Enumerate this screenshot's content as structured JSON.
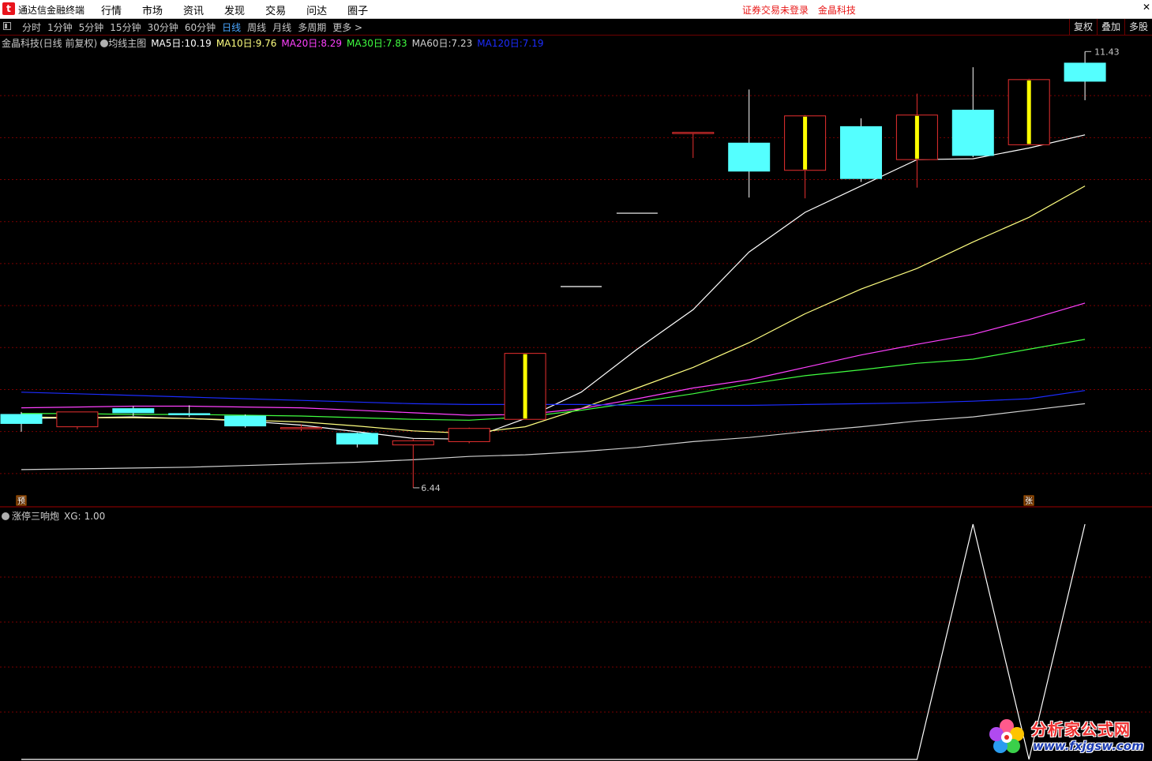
{
  "app": {
    "name": "通达信金融终端",
    "menu": [
      "行情",
      "市场",
      "资讯",
      "发现",
      "交易",
      "问达",
      "圈子"
    ],
    "status_login": "证券交易未登录",
    "status_stock": "金晶科技",
    "close_glyph": "✕"
  },
  "toolbar": {
    "tabs": [
      "分时",
      "1分钟",
      "5分钟",
      "15分钟",
      "30分钟",
      "60分钟",
      "日线",
      "周线",
      "月线",
      "多周期",
      "更多 >"
    ],
    "active_tab": "日线",
    "right_buttons": [
      "复权",
      "叠加",
      "多股"
    ]
  },
  "main_legend": {
    "stock": "金晶科技(日线 前复权)",
    "indicator": "均线主图",
    "ma": [
      {
        "label": "MA5日:",
        "value": "10.19",
        "color": "#ffffff"
      },
      {
        "label": "MA10日:",
        "value": "9.76",
        "color": "#ffff80"
      },
      {
        "label": "MA20日:",
        "value": "8.29",
        "color": "#ff40ff"
      },
      {
        "label": "MA30日:",
        "value": "7.83",
        "color": "#40ff40"
      },
      {
        "label": "MA60日:",
        "value": "7.23",
        "color": "#d0d0d0"
      },
      {
        "label": "MA120日:",
        "value": "7.19",
        "color": "#1c2cff"
      }
    ]
  },
  "sub_legend": {
    "name": "涨停三响炮",
    "label": "XG:",
    "value": "1.00"
  },
  "markers": {
    "low_price_label": "6.44",
    "high_price_label": "11.43",
    "start_tag": "预",
    "limit_tag": "张"
  },
  "watermark": {
    "line1": "分析家公式网",
    "line2": "www.fxjgsw.com"
  },
  "colors": {
    "up": "#e83030",
    "down": "#54ffff",
    "limit_body": "#ffff00",
    "grid": "#7a0000",
    "frame": "#a00000"
  },
  "chart_data": {
    "type": "candlestick",
    "price_range": [
      6.2,
      11.8
    ],
    "candles": [
      {
        "open": 7.33,
        "close": 7.22,
        "high": 7.36,
        "low": 7.12
      },
      {
        "open": 7.18,
        "close": 7.36,
        "high": 7.36,
        "low": 7.15
      },
      {
        "open": 7.4,
        "close": 7.35,
        "high": 7.43,
        "low": 7.31
      },
      {
        "open": 7.34,
        "close": 7.33,
        "high": 7.44,
        "low": 7.3
      },
      {
        "open": 7.31,
        "close": 7.19,
        "high": 7.33,
        "low": 7.17
      },
      {
        "open": 7.17,
        "close": 7.17,
        "high": 7.21,
        "low": 7.13
      },
      {
        "open": 7.1,
        "close": 6.97,
        "high": 7.11,
        "low": 6.93
      },
      {
        "open": 6.96,
        "close": 7.01,
        "high": 7.03,
        "low": 6.44
      },
      {
        "open": 7.0,
        "close": 7.16,
        "high": 7.17,
        "low": 6.98
      },
      {
        "open": 7.27,
        "close": 8.07,
        "high": 8.07,
        "low": 7.27,
        "limit_up": true
      },
      {
        "open": 8.88,
        "close": 8.88,
        "high": 8.88,
        "low": 8.88,
        "one_price": true
      },
      {
        "open": 9.77,
        "close": 9.77,
        "high": 9.77,
        "low": 9.77,
        "one_price": true
      },
      {
        "open": 10.75,
        "close": 10.75,
        "high": 10.75,
        "low": 10.44
      },
      {
        "open": 10.62,
        "close": 10.28,
        "high": 11.27,
        "low": 9.96
      },
      {
        "open": 10.29,
        "close": 10.95,
        "high": 10.96,
        "low": 9.95,
        "limit_up": true
      },
      {
        "open": 10.82,
        "close": 10.19,
        "high": 10.92,
        "low": 10.15
      },
      {
        "open": 10.42,
        "close": 10.96,
        "high": 11.22,
        "low": 10.08,
        "limit_up": true
      },
      {
        "open": 11.02,
        "close": 10.47,
        "high": 11.54,
        "low": 10.45
      },
      {
        "open": 10.6,
        "close": 11.39,
        "high": 11.4,
        "low": 10.6,
        "limit_up": true
      },
      {
        "open": 11.59,
        "close": 11.37,
        "high": 11.73,
        "low": 11.14
      }
    ],
    "series": [
      {
        "name": "MA5日",
        "color": "#ffffff",
        "values": [
          7.28,
          7.29,
          7.3,
          7.28,
          7.25,
          7.2,
          7.12,
          7.04,
          7.03,
          7.28,
          7.6,
          8.12,
          8.6,
          9.3,
          9.78,
          10.1,
          10.42,
          10.43,
          10.56,
          10.72
        ]
      },
      {
        "name": "MA10日",
        "color": "#ffff80",
        "values": [
          7.3,
          7.29,
          7.29,
          7.28,
          7.26,
          7.24,
          7.19,
          7.13,
          7.1,
          7.18,
          7.4,
          7.65,
          7.9,
          8.2,
          8.55,
          8.85,
          9.1,
          9.42,
          9.72,
          10.1
        ]
      },
      {
        "name": "MA20日",
        "color": "#ff40ff",
        "values": [
          7.41,
          7.42,
          7.43,
          7.43,
          7.42,
          7.41,
          7.38,
          7.35,
          7.32,
          7.33,
          7.4,
          7.52,
          7.65,
          7.75,
          7.9,
          8.05,
          8.18,
          8.3,
          8.48,
          8.68
        ]
      },
      {
        "name": "MA30日",
        "color": "#40ff40",
        "values": [
          7.34,
          7.34,
          7.33,
          7.33,
          7.32,
          7.31,
          7.29,
          7.27,
          7.26,
          7.3,
          7.38,
          7.48,
          7.58,
          7.7,
          7.8,
          7.87,
          7.95,
          8.0,
          8.12,
          8.24
        ]
      },
      {
        "name": "MA60日",
        "color": "#d0d0d0",
        "values": [
          6.66,
          6.67,
          6.68,
          6.69,
          6.71,
          6.73,
          6.75,
          6.78,
          6.82,
          6.84,
          6.88,
          6.93,
          7.0,
          7.05,
          7.12,
          7.18,
          7.25,
          7.3,
          7.38,
          7.46
        ]
      },
      {
        "name": "MA120日",
        "color": "#1c2cff",
        "values": [
          7.6,
          7.58,
          7.56,
          7.54,
          7.52,
          7.5,
          7.48,
          7.46,
          7.45,
          7.45,
          7.45,
          7.44,
          7.44,
          7.44,
          7.45,
          7.46,
          7.47,
          7.49,
          7.52,
          7.62
        ]
      }
    ],
    "xg": {
      "name": "XG",
      "range": [
        0,
        1
      ],
      "values": [
        0,
        0,
        0,
        0,
        0,
        0,
        0,
        0,
        0,
        0,
        0,
        0,
        0,
        0,
        0,
        0,
        0,
        1,
        0,
        1
      ]
    }
  }
}
